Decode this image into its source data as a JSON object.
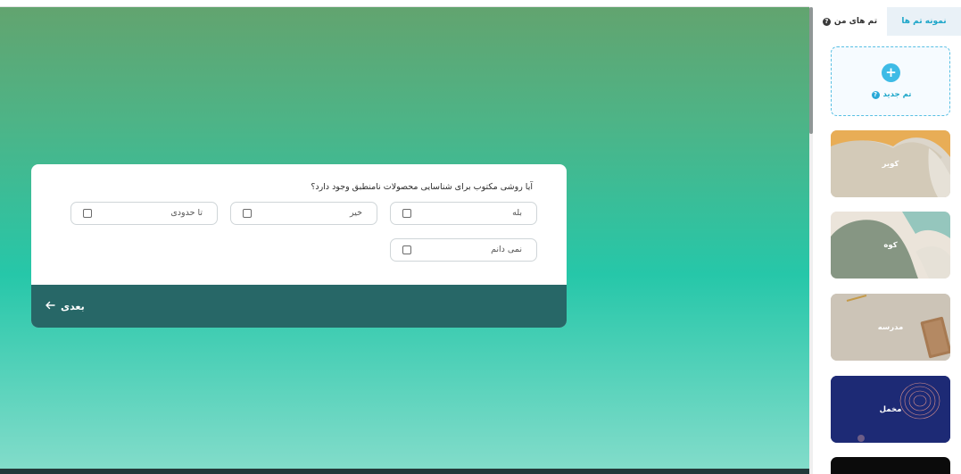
{
  "form": {
    "question": "آیا روشی مکتوب برای شناسایی محصولات نامنطبق وجود دارد؟",
    "options": [
      "بله",
      "خیر",
      "تا حدودی",
      "نمی دانم"
    ],
    "next_label": "بعدی",
    "next_icon": "arrow-left-icon"
  },
  "sidebar": {
    "tabs": {
      "samples": "نمونه تم ها",
      "mine": "تم های من"
    },
    "new_theme_label": "تم جدید",
    "themes": [
      "کویر",
      "کوه",
      "مدرسه",
      "مخمل"
    ]
  },
  "colors": {
    "accent": "#1da6c9",
    "next_bar": "#276767",
    "background_top": "#62a46f",
    "background_mid": "#26c7a9",
    "background_bottom": "#82dcca"
  }
}
